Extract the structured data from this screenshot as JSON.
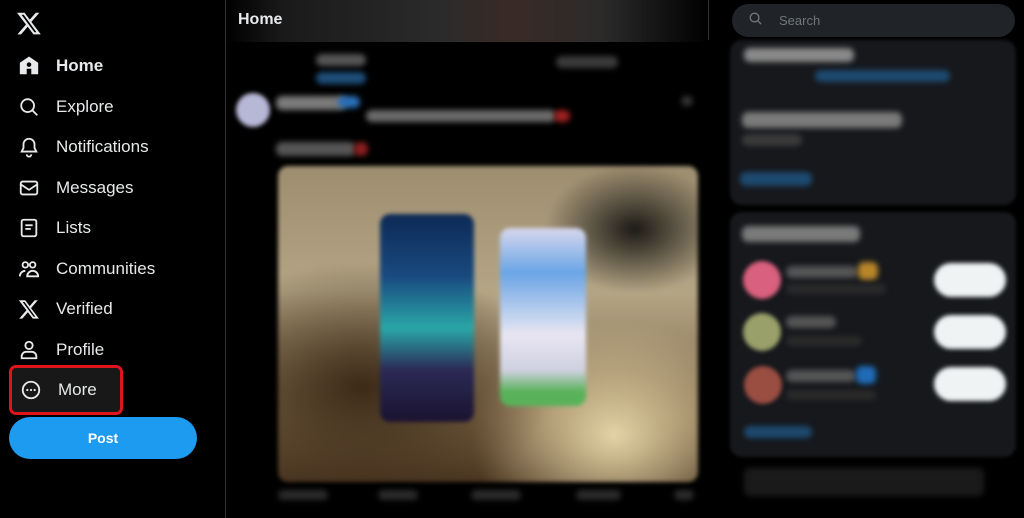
{
  "app": {
    "name": "X"
  },
  "sidebar": {
    "logo_icon": "x-logo-icon",
    "items": [
      {
        "label": "Home",
        "icon": "home-icon",
        "active": true
      },
      {
        "label": "Explore",
        "icon": "search-icon"
      },
      {
        "label": "Notifications",
        "icon": "bell-icon"
      },
      {
        "label": "Messages",
        "icon": "envelope-icon"
      },
      {
        "label": "Lists",
        "icon": "list-icon"
      },
      {
        "label": "Communities",
        "icon": "people-icon"
      },
      {
        "label": "Verified",
        "icon": "x-logo-icon"
      },
      {
        "label": "Profile",
        "icon": "person-icon"
      },
      {
        "label": "More",
        "icon": "more-circle-icon",
        "highlighted": true
      }
    ],
    "post_label": "Post"
  },
  "main": {
    "header_title": "Home"
  },
  "right": {
    "search_placeholder": "Search"
  },
  "colors": {
    "accent": "#1d9bf0",
    "highlight_box": "#e0141b",
    "background": "#000000",
    "card": "#16181c"
  }
}
